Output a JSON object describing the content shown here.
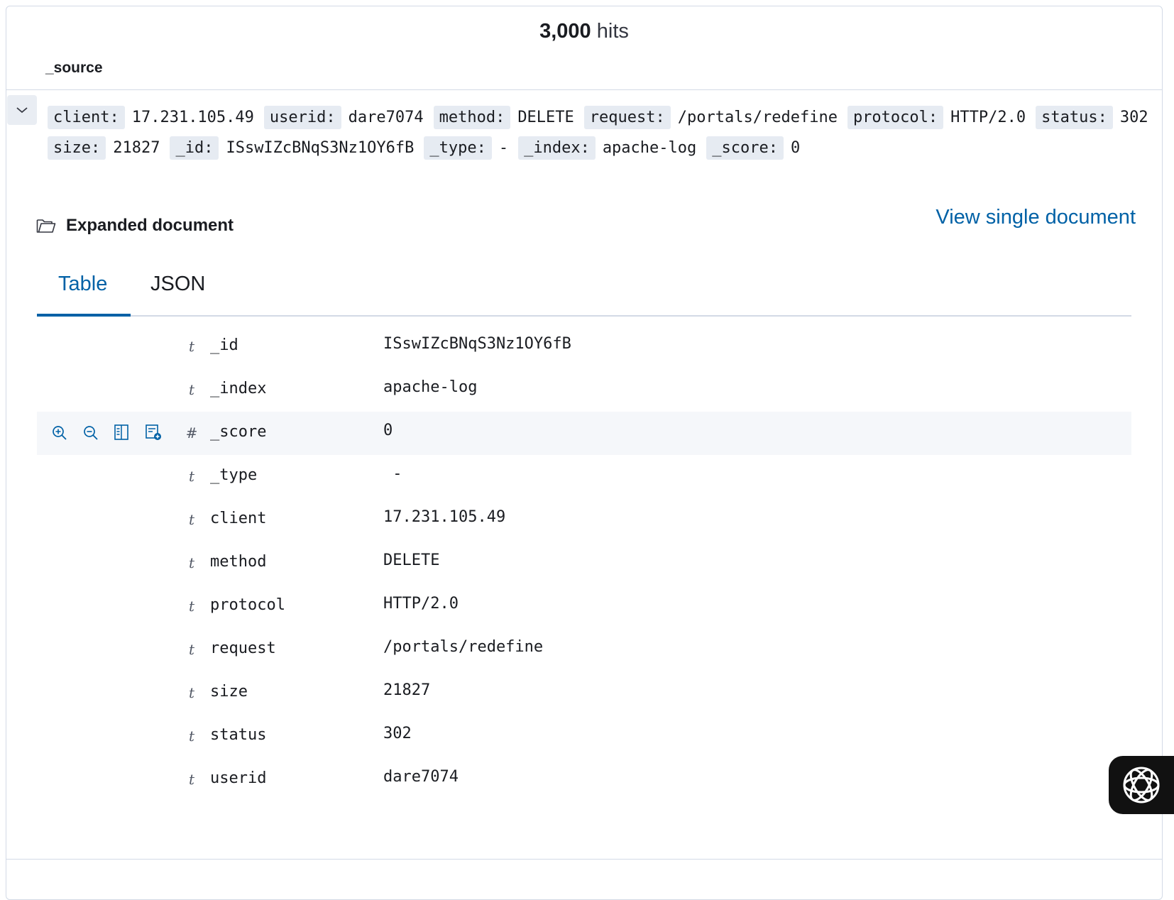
{
  "hits": {
    "count": "3,000",
    "label": "hits"
  },
  "source_column": "_source",
  "source_row": {
    "line1": [
      {
        "k": "client:",
        "v": "17.231.105.49"
      },
      {
        "k": "userid:",
        "v": "dare7074"
      },
      {
        "k": "method:",
        "v": "DELETE"
      },
      {
        "k": "request:",
        "v": "/portals/redefine"
      },
      {
        "k": "protocol:",
        "v": "HTTP/2.0"
      },
      {
        "k": "status:",
        "v": "302"
      }
    ],
    "line2": [
      {
        "k": "size:",
        "v": "21827"
      },
      {
        "k": "_id:",
        "v": "ISswIZcBNqS3Nz1OY6fB"
      },
      {
        "k": "_type:",
        "v": "-"
      },
      {
        "k": "_index:",
        "v": "apache-log"
      },
      {
        "k": "_score:",
        "v": "0"
      }
    ]
  },
  "expanded": {
    "title": "Expanded document",
    "view_single": "View single document"
  },
  "tabs": {
    "table": "Table",
    "json": "JSON"
  },
  "fields": [
    {
      "type": "t",
      "name": "_id",
      "value": "ISswIZcBNqS3Nz1OY6fB"
    },
    {
      "type": "t",
      "name": "_index",
      "value": "apache-log"
    },
    {
      "type": "#",
      "name": "_score",
      "value": "0"
    },
    {
      "type": "t",
      "name": "_type",
      "value": " -"
    },
    {
      "type": "t",
      "name": "client",
      "value": "17.231.105.49"
    },
    {
      "type": "t",
      "name": "method",
      "value": "DELETE"
    },
    {
      "type": "t",
      "name": "protocol",
      "value": "HTTP/2.0"
    },
    {
      "type": "t",
      "name": "request",
      "value": "/portals/redefine"
    },
    {
      "type": "t",
      "name": "size",
      "value": "21827"
    },
    {
      "type": "t",
      "name": "status",
      "value": "302"
    },
    {
      "type": "t",
      "name": "userid",
      "value": "dare7074"
    }
  ],
  "colors": {
    "accent": "#0061a6",
    "pill_bg": "#e6ebf2",
    "border": "#d3dae6"
  }
}
